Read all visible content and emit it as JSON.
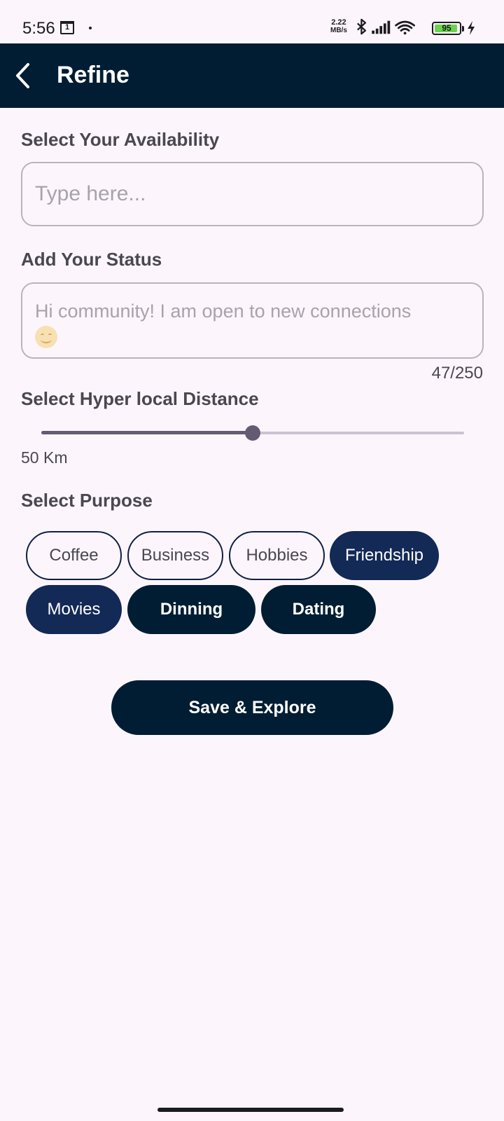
{
  "status_bar": {
    "time": "5:56",
    "calendar_day": "1",
    "net_speed_value": "2.22",
    "net_speed_unit": "MB/s",
    "battery_level": "95",
    "battery_fraction": 0.95
  },
  "app_bar": {
    "title": "Refine"
  },
  "availability": {
    "label": "Select Your Availability",
    "placeholder": "Type here..."
  },
  "status": {
    "label": "Add Your Status",
    "placeholder": "Hi community! I am open to new connections",
    "counter": "47/250"
  },
  "distance": {
    "label": "Select Hyper local Distance",
    "value_text": "50 Km",
    "slider_fraction": 0.5
  },
  "purpose": {
    "label": "Select Purpose",
    "chips": [
      {
        "label": "Coffee",
        "state": "outline"
      },
      {
        "label": "Business",
        "state": "outline"
      },
      {
        "label": "Hobbies",
        "state": "outline"
      },
      {
        "label": "Friendship",
        "state": "selected"
      },
      {
        "label": "Movies",
        "state": "selected"
      },
      {
        "label": "Dinning",
        "state": "dark"
      },
      {
        "label": "Dating",
        "state": "dark"
      }
    ]
  },
  "actions": {
    "save_label": "Save & Explore"
  },
  "colors": {
    "app_bar": "#001d33",
    "chip_selected": "#132956",
    "background": "#fcf6fc",
    "slider": "#625b71"
  }
}
